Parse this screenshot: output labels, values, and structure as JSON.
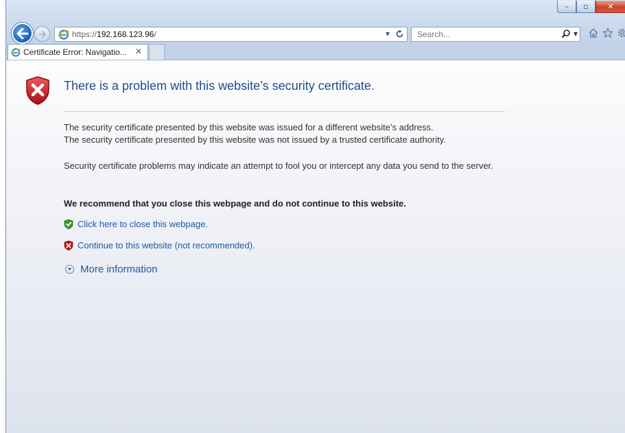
{
  "window": {
    "controls": {
      "minimize": "–",
      "maximize": "▫",
      "close": "✕"
    }
  },
  "nav": {
    "back_icon": "back-arrow-icon",
    "forward_icon": "forward-arrow-icon"
  },
  "address_bar": {
    "scheme": "https://",
    "host": "192.168.123.96",
    "path": "/",
    "dropdown": "▾",
    "refresh": "C"
  },
  "search": {
    "placeholder": "Search..."
  },
  "tab": {
    "title": "Certificate Error: Navigatio...",
    "close": "✕"
  },
  "page": {
    "headline": "There is a problem with this website’s security certificate.",
    "para1_line1": "The security certificate presented by this website was issued for a different website’s address.",
    "para1_line2": "The security certificate presented by this website was not issued by a trusted certificate authority.",
    "para2": "Security certificate problems may indicate an attempt to fool you or intercept any data you send to the server.",
    "recommendation": "We recommend that you close this webpage and do not continue to this website.",
    "close_link": "Click here to close this webpage.",
    "continue_link": "Continue to this website (not recommended).",
    "more_info": "More information"
  },
  "colors": {
    "link": "#1f57a4",
    "headline": "#1f4e8c",
    "shield_red": "#c8161d",
    "shield_green": "#3a9a2c"
  }
}
